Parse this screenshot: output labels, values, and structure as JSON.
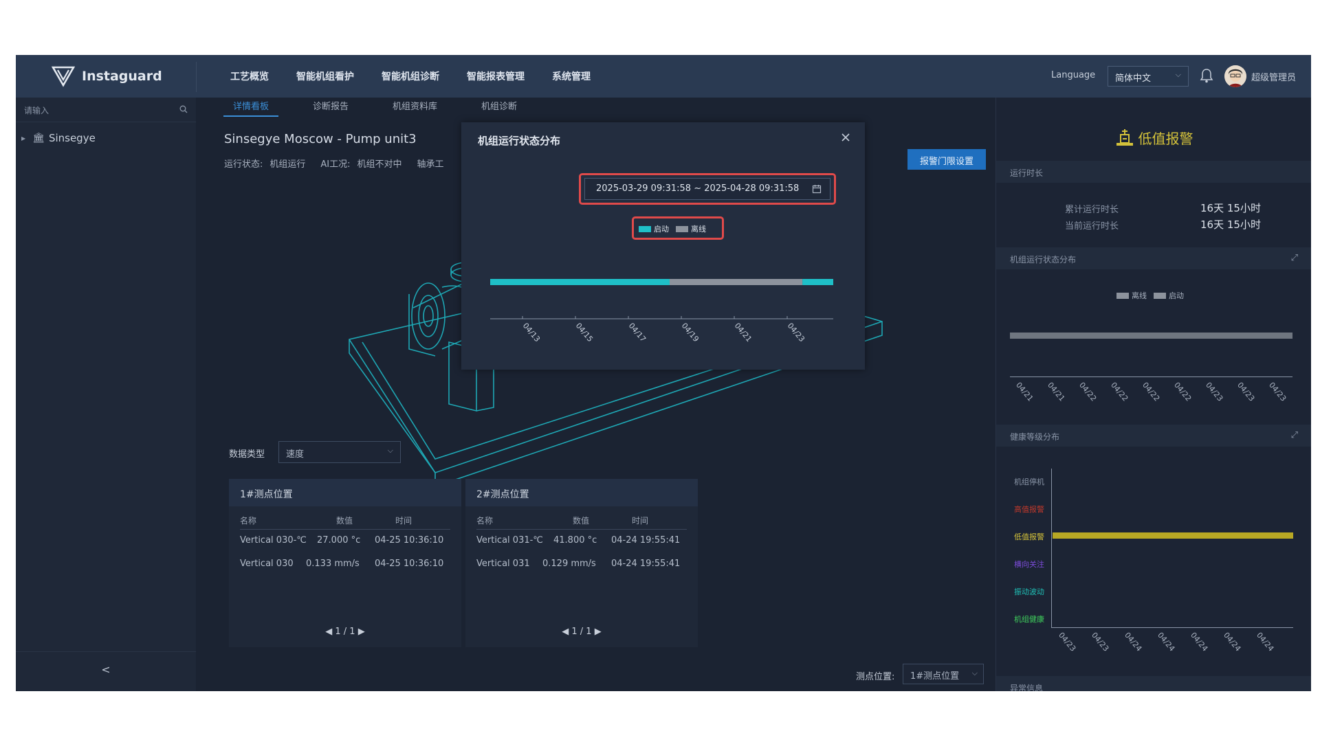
{
  "app": {
    "name": "Instaguard"
  },
  "nav": {
    "items": [
      "工艺概览",
      "智能机组看护",
      "智能机组诊断",
      "智能报表管理",
      "系统管理"
    ]
  },
  "header": {
    "language_label": "Language",
    "language_value": "简体中文",
    "user": "超级管理员"
  },
  "sidebar": {
    "search_placeholder": "请输入",
    "tree_root": "Sinsegye",
    "collapse_symbol": "<"
  },
  "subtabs": [
    "详情看板",
    "诊断报告",
    "机组资料库",
    "机组诊断"
  ],
  "unit": {
    "title": "Sinsegye Moscow - Pump unit3",
    "status_label": "运行状态:",
    "status_value": "机组运行",
    "ai_label": "AI工况:",
    "ai_value": "机组不对中",
    "bearing_label": "轴承工",
    "alarm_settings_button": "报警门限设置"
  },
  "data_type": {
    "label": "数据类型",
    "value": "速度"
  },
  "measure_cards": [
    {
      "title": "1#测点位置",
      "headers": [
        "名称",
        "数值",
        "时间"
      ],
      "rows": [
        {
          "name": "Vertical 030-℃",
          "value": "27.000 °c",
          "time": "04-25 10:36:10"
        },
        {
          "name": "Vertical 030",
          "value": "0.133 mm/s",
          "time": "04-25 10:36:10"
        }
      ],
      "pager": "◀ 1 / 1 ▶"
    },
    {
      "title": "2#测点位置",
      "headers": [
        "名称",
        "数值",
        "时间"
      ],
      "rows": [
        {
          "name": "Vertical 031-℃",
          "value": "41.800 °c",
          "time": "04-24 19:55:41"
        },
        {
          "name": "Vertical 031",
          "value": "0.129 mm/s",
          "time": "04-24 19:55:41"
        }
      ],
      "pager": "◀ 1 / 1 ▶"
    }
  ],
  "measure_position": {
    "label": "测点位置:",
    "value": "1#测点位置"
  },
  "right_panel": {
    "alarm_title": "低值报警",
    "runtime_section": "运行时长",
    "runtime_rows": [
      {
        "label": "累计运行时长",
        "value": "16天 15小时"
      },
      {
        "label": "当前运行时长",
        "value": "16天 15小时"
      }
    ],
    "status_section": "机组运行状态分布",
    "status_legend": [
      "离线",
      "启动"
    ],
    "status_ticks": [
      "04/21",
      "04/21",
      "04/22",
      "04/22",
      "04/22",
      "04/22",
      "04/23",
      "04/23",
      "04/23"
    ],
    "health_section": "健康等级分布",
    "health_levels": [
      "机组停机",
      "高值报警",
      "低值报警",
      "横向关注",
      "振动波动",
      "机组健康"
    ],
    "health_ticks": [
      "04/23",
      "04/23",
      "04/24",
      "04/24",
      "04/24",
      "04/24",
      "04/24"
    ],
    "abnormal_section": "异常信息"
  },
  "modal": {
    "title": "机组运行状态分布",
    "date_range": "2025-03-29 09:31:58 ~ 2025-04-28 09:31:58",
    "legend": [
      "启动",
      "离线"
    ]
  },
  "colors": {
    "start": "#1fc0c8",
    "offline": "#8d939d",
    "low_alarm": "#b8a824",
    "accent": "#1f6fbf",
    "highlight": "#e04a4a"
  },
  "chart_data": [
    {
      "type": "bar",
      "title": "机组运行状态分布",
      "orientation": "horizontal-timeline",
      "x_ticks": [
        "04/13",
        "04/15",
        "04/17",
        "04/19",
        "04/21",
        "04/23"
      ],
      "series": [
        {
          "name": "启动",
          "segments": [
            [
              0.0,
              0.523
            ],
            [
              0.91,
              1.0
            ]
          ]
        },
        {
          "name": "离线",
          "segments": [
            [
              0.523,
              0.91
            ]
          ]
        }
      ]
    }
  ]
}
